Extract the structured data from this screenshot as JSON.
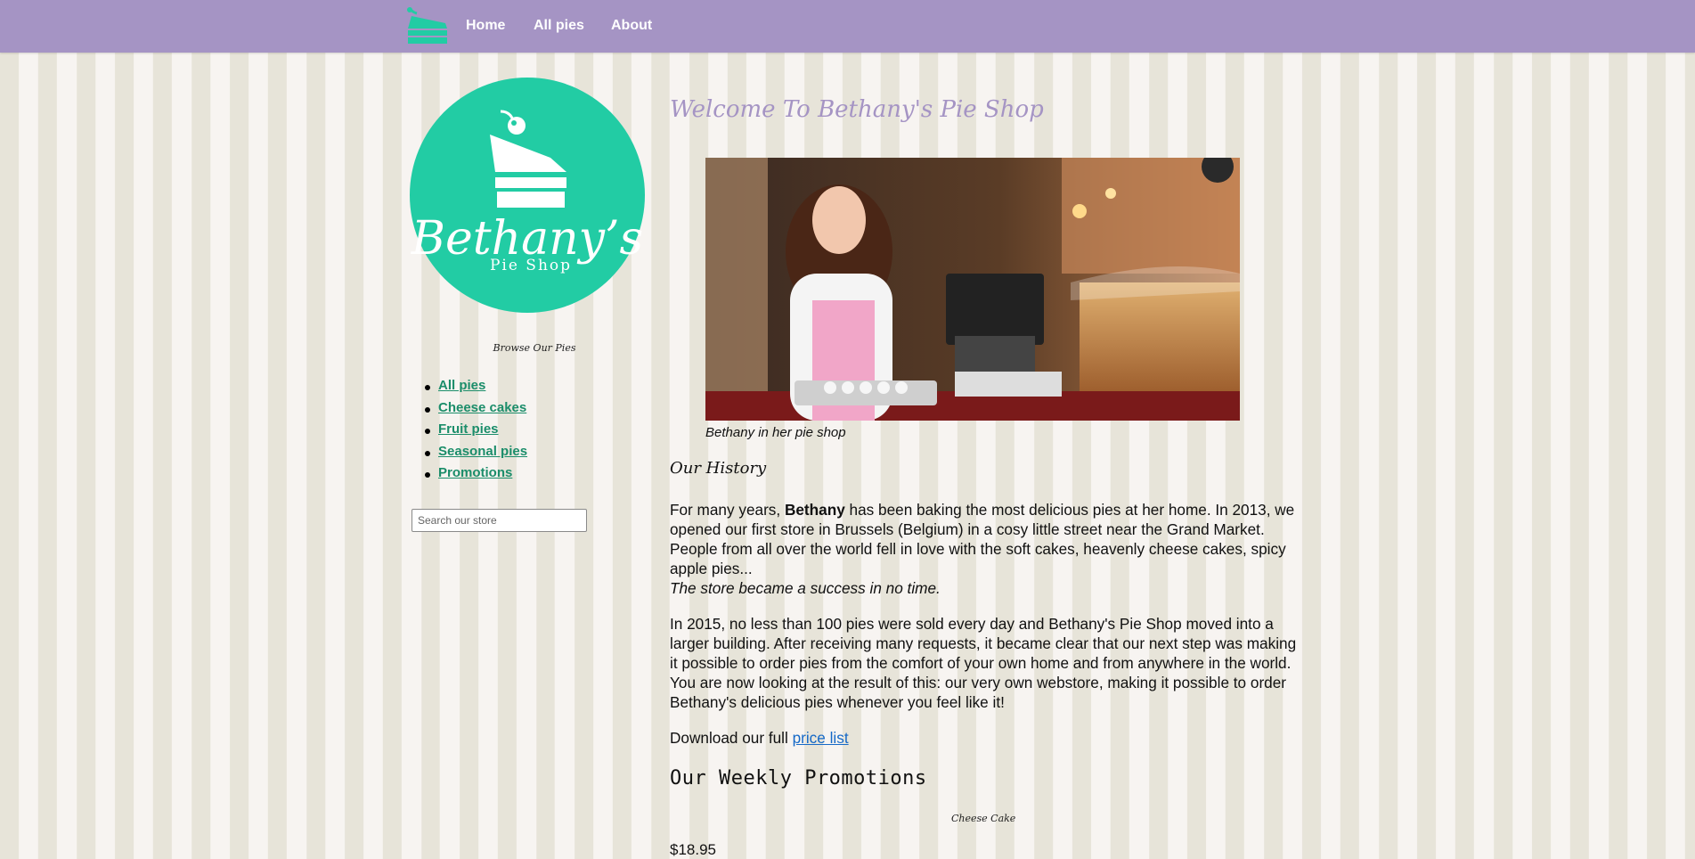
{
  "nav": {
    "logo_icon": "cake-slice-icon",
    "links": [
      "Home",
      "All pies",
      "About"
    ]
  },
  "sidebar": {
    "logo": {
      "name": "Bethany’s",
      "subtitle": "Pie Shop"
    },
    "browse_title": "Browse Our Pies",
    "categories": [
      "All pies",
      "Cheese cakes",
      "Fruit pies",
      "Seasonal pies",
      "Promotions"
    ],
    "search_placeholder": "Search our store"
  },
  "main": {
    "welcome_title": "Welcome To Bethany's Pie Shop",
    "hero_caption": "Bethany in her pie shop",
    "history_title": "Our History",
    "para1_lead": "For many years, ",
    "para1_bold": "Bethany",
    "para1_rest": " has been baking the most delicious pies at her home. In 2013, we opened our first store in Brussels (Belgium) in a cosy little street near the Grand Market. People from all over the world fell in love with the soft cakes, heavenly cheese cakes, spicy apple pies...",
    "para1_italic": "The store became a success in no time.",
    "para2": "In 2015, no less than 100 pies were sold every day and Bethany's Pie Shop moved into a larger building. After receiving many requests, it became clear that our next step was making it possible to order pies from the comfort of your own home and from anywhere in the world. You are now looking at the result of this: our very own webstore, making it possible to order Bethany's delicious pies whenever you feel like it!",
    "download_text": "Download our full ",
    "download_link": "price list",
    "promotions_title": "Our Weekly Promotions",
    "promo_item_name": "Cheese Cake",
    "promo_price_partial": "$18.95"
  },
  "colors": {
    "navbar": "#a594c4",
    "brand_teal": "#22cca4",
    "link_green": "#1b8d6a",
    "link_blue": "#1669c7"
  }
}
